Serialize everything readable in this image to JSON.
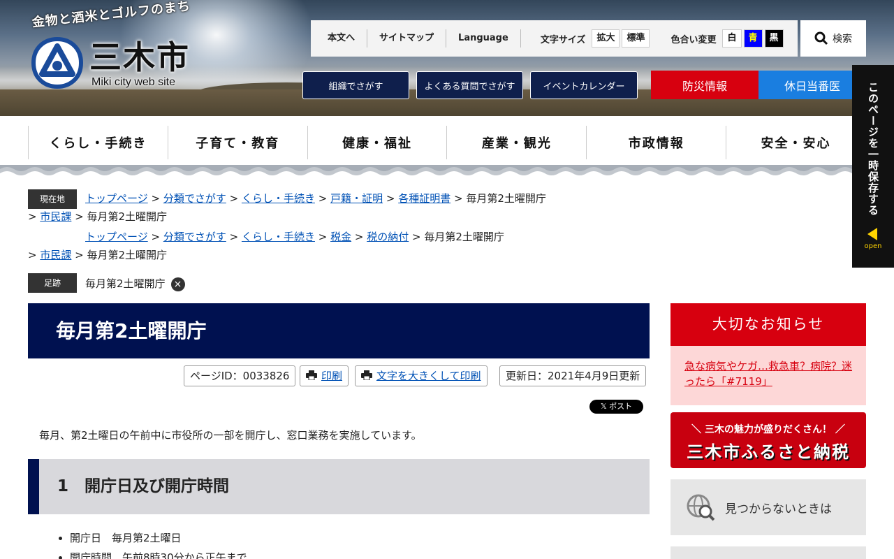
{
  "header": {
    "tagline": "金物と酒米とゴルフのまち",
    "city_name": "三木市",
    "city_sub": "Miki city web site",
    "util_links": [
      "本文へ",
      "サイトマップ",
      "Language"
    ],
    "font_size_label": "文字サイズ",
    "font_size_buttons": [
      "拡大",
      "標準"
    ],
    "color_label": "色合い変更",
    "color_buttons": [
      "白",
      "青",
      "黒"
    ],
    "search_label": "検索",
    "nav_buttons": [
      "組織でさがす",
      "よくある質問でさがす",
      "イベントカレンダー"
    ],
    "bousai": "防災情報",
    "kyujitsu": "休日当番医"
  },
  "gnav": [
    "くらし・手続き",
    "子育て・教育",
    "健康・福祉",
    "産業・観光",
    "市政情報",
    "安全・安心"
  ],
  "sidetab": {
    "text": "このページを一時保存する",
    "open": "open"
  },
  "breadcrumb": {
    "current_label": "現在地",
    "path1": [
      "トップページ",
      "分類でさがす",
      "くらし・手続き",
      "戸籍・証明",
      "各種証明書"
    ],
    "path2": [
      "トップページ",
      "分類でさがす",
      "くらし・手続き",
      "税金",
      "税の納付"
    ],
    "section": "市民課",
    "current": "毎月第2土曜開庁",
    "footprint_label": "足跡",
    "footprint": "毎月第2土曜開庁"
  },
  "main": {
    "title": "毎月第2土曜開庁",
    "page_id": "ページID：0033826",
    "print": "印刷",
    "print_large": "文字を大きくして印刷",
    "updated": "更新日：2021年4月9日更新",
    "post": "ポスト",
    "intro": "毎月、第2土曜日の午前中に市役所の一部を開庁し、窓口業務を実施しています。",
    "h2": "1　開庁日及び開庁時間",
    "list": [
      "開庁日　毎月第2土曜日",
      "開庁時間　午前8時30分から正午まで"
    ]
  },
  "side": {
    "notice_head": "大切なお知らせ",
    "notice_link": "急な病気やケガ…救急車？病院？迷ったら「#7119」",
    "furusato_sub": "＼ 三木の魅力が盛りだくさん！ ／",
    "furusato_main": "三木市ふるさと納税",
    "notfound": "見つからないときは"
  },
  "colors": {
    "navy": "#001150",
    "red": "#d7000f",
    "blue": "#1a7ee0",
    "link": "#0051b5"
  }
}
